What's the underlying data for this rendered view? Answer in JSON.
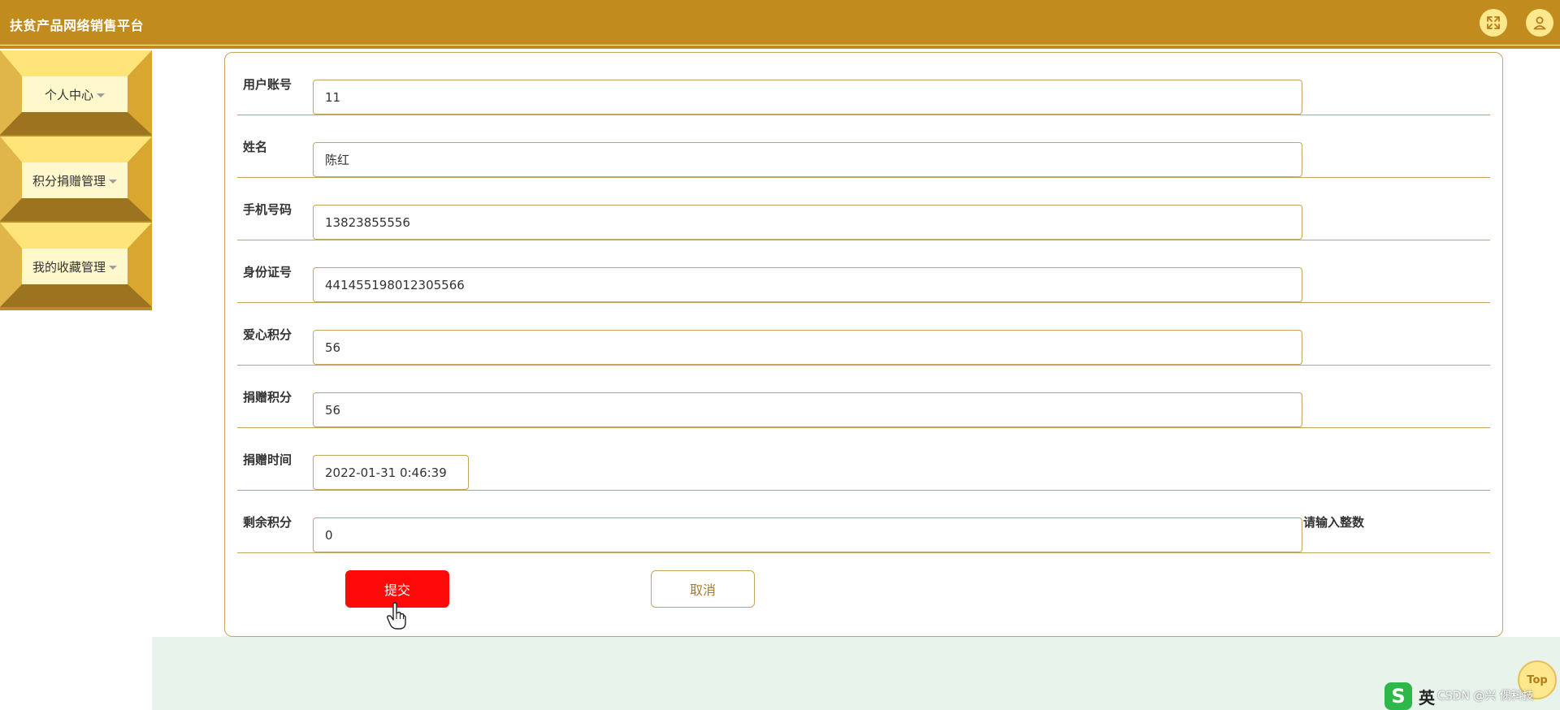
{
  "app": {
    "title": "扶贫产品网络销售平台"
  },
  "header": {
    "fullscreen_icon": "expand-arrows-icon",
    "user_icon": "user-icon"
  },
  "sidebar": {
    "items": [
      {
        "label": "个人中心"
      },
      {
        "label": "积分捐赠管理"
      },
      {
        "label": "我的收藏管理"
      }
    ]
  },
  "form": {
    "fields": [
      {
        "label": "用户账号",
        "value": "11"
      },
      {
        "label": "姓名",
        "value": "陈红"
      },
      {
        "label": "手机号码",
        "value": "13823855556"
      },
      {
        "label": "身份证号",
        "value": "441455198012305566"
      },
      {
        "label": "爱心积分",
        "value": "56"
      },
      {
        "label": "捐赠积分",
        "value": "56"
      },
      {
        "label": "捐赠时间",
        "value": "2022-01-31 0:46:39"
      },
      {
        "label": "剩余积分",
        "value": "0",
        "hint": "请输入整数"
      }
    ],
    "submit_label": "提交",
    "cancel_label": "取消"
  },
  "footer": {
    "top_label": "Top",
    "watermark": "CSDN @兴 偶科技",
    "ime_badge": "S",
    "ime_lang": "英"
  },
  "colors": {
    "header": "#c18b1e",
    "sidebar": "#b98e29",
    "tile_face": "#fff8cc",
    "card_border": "#c3a55c",
    "submit": "#ff0a0a",
    "bottom_band": "#e8f3ec"
  }
}
